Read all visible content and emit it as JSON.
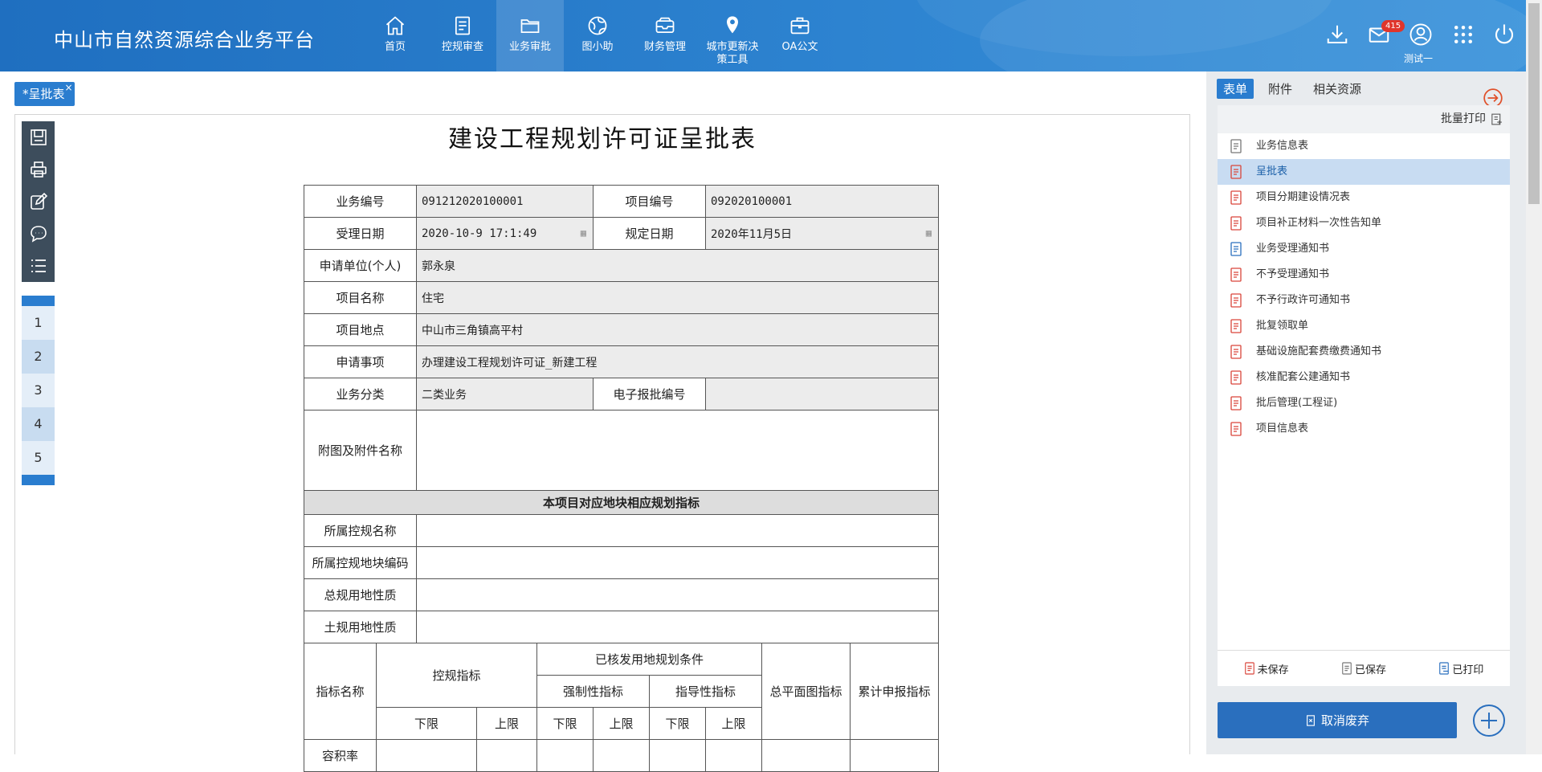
{
  "app": {
    "title": "中山市自然资源综合业务平台"
  },
  "nav": [
    {
      "label": "首页",
      "icon": "home-icon"
    },
    {
      "label": "控规审查",
      "icon": "document-icon"
    },
    {
      "label": "业务审批",
      "icon": "folder-icon",
      "active": true
    },
    {
      "label": "图小助",
      "icon": "globe-icon"
    },
    {
      "label": "财务管理",
      "icon": "inbox-icon"
    },
    {
      "label": "城市更新决",
      "label2": "策工具",
      "icon": "location-pin-icon"
    },
    {
      "label": "OA公文",
      "icon": "briefcase-icon"
    }
  ],
  "header": {
    "mail_badge": "415",
    "user_name": "测试一"
  },
  "doc_tab": {
    "label": "*呈批表",
    "close": "×"
  },
  "page_numbers": [
    "1",
    "2",
    "3",
    "4",
    "5"
  ],
  "form": {
    "title": "建设工程规划许可证呈批表",
    "business_no_label": "业务编号",
    "business_no": "091212020100001",
    "project_no_label": "项目编号",
    "project_no": "092020100001",
    "accept_date_label": "受理日期",
    "accept_date": "2020-10-9 17:1:49",
    "due_date_label": "规定日期",
    "due_date": "2020年11月5日",
    "applicant_label": "申请单位(个人)",
    "applicant": "郭永泉",
    "project_name_label": "项目名称",
    "project_name": "住宅",
    "location_label": "项目地点",
    "location": "中山市三角镇高平村",
    "matter_label": "申请事项",
    "matter": "办理建设工程规划许可证_新建工程",
    "category_label": "业务分类",
    "category": "二类业务",
    "e_no_label": "电子报批编号",
    "e_no": "",
    "attachments_label": "附图及附件名称",
    "section_header": "本项目对应地块相应规划指标",
    "ctrl_plan_name_label": "所属控规名称",
    "ctrl_plot_code_label": "所属控规地块编码",
    "master_land_label": "总规用地性质",
    "land_use_label": "土规用地性质",
    "index_name": "指标名称",
    "ctrl_index": "控规指标",
    "issued_cond": "已核发用地规划条件",
    "mandatory": "强制性指标",
    "guidance": "指导性指标",
    "site_plan": "总平面图指标",
    "cumulative": "累计申报指标",
    "lower": "下限",
    "upper": "上限",
    "far_label": "容积率"
  },
  "right_panel": {
    "tabs": [
      "表单",
      "附件",
      "相关资源"
    ],
    "batch_print": "批量打印",
    "items": [
      {
        "label": "业务信息表",
        "state": "saved"
      },
      {
        "label": "呈批表",
        "state": "unsaved",
        "selected": true
      },
      {
        "label": "项目分期建设情况表",
        "state": "unsaved"
      },
      {
        "label": "项目补正材料一次性告知单",
        "state": "unsaved"
      },
      {
        "label": "业务受理通知书",
        "state": "printed"
      },
      {
        "label": "不予受理通知书",
        "state": "unsaved"
      },
      {
        "label": "不予行政许可通知书",
        "state": "unsaved"
      },
      {
        "label": "批复领取单",
        "state": "unsaved"
      },
      {
        "label": "基础设施配套费缴费通知书",
        "state": "unsaved"
      },
      {
        "label": "核准配套公建通知书",
        "state": "unsaved"
      },
      {
        "label": "批后管理(工程证)",
        "state": "unsaved"
      },
      {
        "label": "项目信息表",
        "state": "unsaved"
      }
    ],
    "legend": {
      "unsaved": "未保存",
      "saved": "已保存",
      "printed": "已打印"
    },
    "cancel_button": "取消废弃"
  },
  "colors": {
    "header_blue": "#2a7dcf",
    "unsaved_red": "#d9453a",
    "saved_gray": "#777777",
    "printed_blue": "#2a6fbe"
  }
}
